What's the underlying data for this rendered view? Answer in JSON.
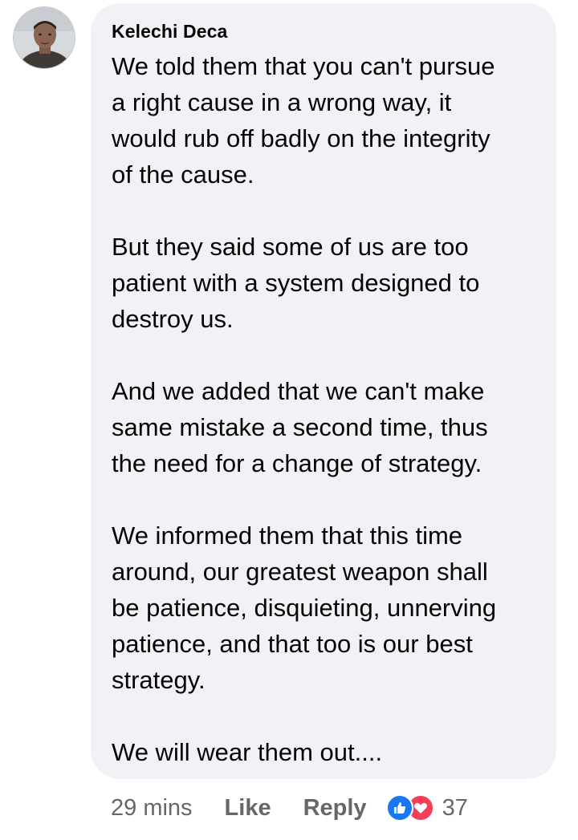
{
  "comment": {
    "author": "Kelechi Deca",
    "paragraphs": [
      [
        "We told them that you can't pursue",
        "a right cause in a wrong way, it",
        "would rub off badly on the integrity",
        "of the cause."
      ],
      [
        "But they said some of us are too",
        "patient with a system designed to",
        "destroy us."
      ],
      [
        "And we added that we can't make",
        "same mistake a second time, thus",
        "the need for a change of strategy."
      ],
      [
        "We informed them that this time",
        "around, our greatest weapon shall",
        "be patience, disquieting, unnerving",
        "patience, and that too is our best",
        "strategy."
      ],
      [
        "We will wear them out...."
      ]
    ]
  },
  "actions": {
    "timestamp": "29 mins",
    "like_label": "Like",
    "reply_label": "Reply",
    "reaction_icons": [
      "like-reaction-icon",
      "love-reaction-icon"
    ],
    "reaction_count": "37"
  },
  "colors": {
    "bubble_bg": "#f0f2f5",
    "text": "#050505",
    "meta_text": "#65676b",
    "like_blue": "#1877f2",
    "love_red": "#f33e58"
  }
}
